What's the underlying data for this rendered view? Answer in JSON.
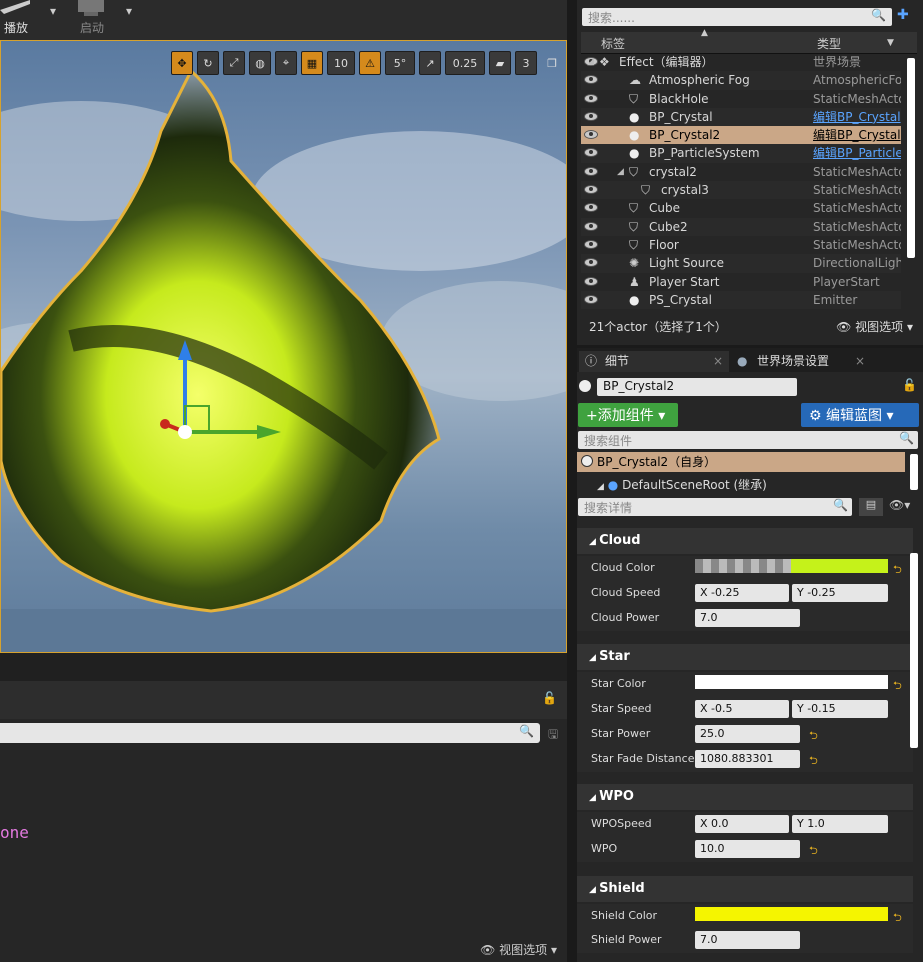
{
  "toolbar": {
    "play_label": "播放",
    "launch_label": "启动"
  },
  "viewport": {
    "toolbar": {
      "grid_snap": "10",
      "rotate_snap": "5°",
      "scale_snap": "0.25",
      "camera_speed": "3"
    }
  },
  "bottom_left": {
    "code_text": "one",
    "view_options": "视图选项"
  },
  "outliner": {
    "search_placeholder": "搜索......",
    "col_label": "标签",
    "col_type": "类型",
    "rows": [
      {
        "name": "Effect（编辑器）",
        "type": "世界场景"
      },
      {
        "name": "Atmospheric Fog",
        "type": "AtmosphericFog"
      },
      {
        "name": "BlackHole",
        "type": "StaticMeshActor"
      },
      {
        "name": "BP_Crystal",
        "type": "编辑BP_Crystal"
      },
      {
        "name": "BP_Crystal2",
        "type": "编辑BP_Crystal"
      },
      {
        "name": "BP_ParticleSystem",
        "type": "编辑BP_Particle"
      },
      {
        "name": "crystal2",
        "type": "StaticMeshActor"
      },
      {
        "name": "crystal3",
        "type": "StaticMeshActor"
      },
      {
        "name": "Cube",
        "type": "StaticMeshActor"
      },
      {
        "name": "Cube2",
        "type": "StaticMeshActor"
      },
      {
        "name": "Floor",
        "type": "StaticMeshActor"
      },
      {
        "name": "Light Source",
        "type": "DirectionalLight"
      },
      {
        "name": "Player Start",
        "type": "PlayerStart"
      },
      {
        "name": "PS_Crystal",
        "type": "Emitter"
      }
    ],
    "status": "21个actor（选择了1个）",
    "view_options": "视图选项"
  },
  "details": {
    "tab_details": "细节",
    "tab_world": "世界场景设置",
    "actor_name": "BP_Crystal2",
    "add_component": "+添加组件",
    "edit_blueprint": "编辑蓝图",
    "component_search": "搜索组件",
    "component_self": "BP_Crystal2（自身）",
    "component_root": "DefaultSceneRoot (继承)",
    "detail_search": "搜索详情",
    "cloud": {
      "title": "Cloud",
      "color_label": "Cloud Color",
      "speed_label": "Cloud Speed",
      "speed_x": "X  -0.25",
      "speed_y": "Y  -0.25",
      "power_label": "Cloud Power",
      "power": "7.0",
      "color": "#c5f21a"
    },
    "star": {
      "title": "Star",
      "color_label": "Star Color",
      "speed_label": "Star Speed",
      "speed_x": "X  -0.5",
      "speed_y": "Y  -0.15",
      "power_label": "Star Power",
      "power": "25.0",
      "fade_label": "Star Fade Distance",
      "fade": "1080.883301",
      "color": "#ffffff"
    },
    "wpo": {
      "title": "WPO",
      "speed_label": "WPOSpeed",
      "speed_x": "X  0.0",
      "speed_y": "Y  1.0",
      "wpo_label": "WPO",
      "wpo": "10.0"
    },
    "shield": {
      "title": "Shield",
      "color_label": "Shield Color",
      "power_label": "Shield Power",
      "power": "7.0",
      "color": "#f5f500"
    }
  }
}
